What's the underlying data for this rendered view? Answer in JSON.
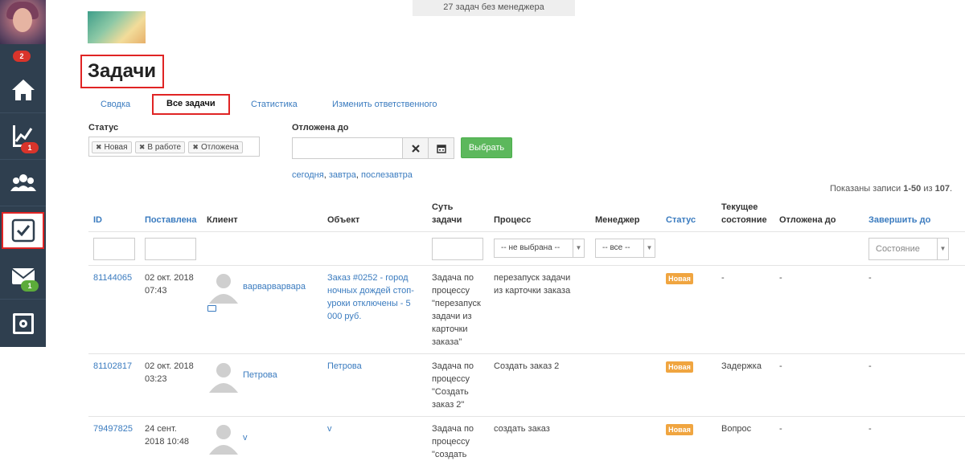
{
  "sidebar": {
    "avatar_badge": "2",
    "items": [
      {
        "name": "home",
        "badge": ""
      },
      {
        "name": "stats",
        "badge": "1"
      },
      {
        "name": "clients",
        "badge": ""
      },
      {
        "name": "tasks",
        "badge": ""
      },
      {
        "name": "mail",
        "badge": "1"
      },
      {
        "name": "safe",
        "badge": ""
      }
    ]
  },
  "header": {
    "banner": "27 задач без менеджера",
    "title": "Задачи"
  },
  "tabs": [
    "Сводка",
    "Все задачи",
    "Статистика",
    "Изменить ответственного"
  ],
  "filters": {
    "status_label": "Статус",
    "status_chips": [
      "Новая",
      "В работе",
      "Отложена"
    ],
    "postponed_label": "Отложена до",
    "choose_button": "Выбрать",
    "quick_today": "сегодня",
    "quick_tomorrow": "завтра",
    "quick_after": "послезавтра"
  },
  "records": {
    "prefix": "Показаны записи ",
    "range": "1-50",
    "middle": " из ",
    "total": "107",
    "suffix": "."
  },
  "table": {
    "headers": {
      "id": "ID",
      "created": "Поставлена",
      "client": "Клиент",
      "object": "Объект",
      "essence_1": "Суть",
      "essence_2": "задачи",
      "process": "Процесс",
      "manager": "Менеджер",
      "status": "Статус",
      "current_1": "Текущее",
      "current_2": "состояние",
      "postponed": "Отложена до",
      "finish": "Завершить до"
    },
    "filter_process": "-- не выбрана --",
    "filter_manager": "-- все --",
    "filter_state": "Состояние",
    "rows": [
      {
        "id": "81144065",
        "date": "02 окт. 2018",
        "time": "07:43",
        "client": "варварварвара",
        "object": [
          "Заказ #0252 - город",
          "ночных дождей стоп-",
          "уроки отключены - 5",
          "000 руб."
        ],
        "essence": [
          "Задача по",
          "процессу",
          "\"перезапуск",
          "задачи из",
          "карточки",
          "заказа\""
        ],
        "process": [
          "перезапуск задачи",
          "из карточки заказа"
        ],
        "status": "Новая",
        "current": "-",
        "postponed": "-",
        "finish": "-"
      },
      {
        "id": "81102817",
        "date": "02 окт. 2018",
        "time": "03:23",
        "client": "Петрова",
        "object": [
          "Петрова"
        ],
        "essence": [
          "Задача по",
          "процессу",
          "\"Создать",
          "заказ 2\""
        ],
        "process": [
          "Создать заказ 2"
        ],
        "status": "Новая",
        "current": "Задержка",
        "postponed": "-",
        "finish": "-"
      },
      {
        "id": "79497825",
        "date": "24 сент.",
        "time": "2018 10:48",
        "client": "v",
        "object": [
          "v"
        ],
        "essence": [
          "Задача по",
          "процессу",
          "\"создать"
        ],
        "process": [
          "создать заказ"
        ],
        "status": "Новая",
        "current": "Вопрос",
        "postponed": "-",
        "finish": "-"
      }
    ]
  },
  "colors": {
    "sidebar": "#2f3f4f",
    "link": "#3a7bbf",
    "highlight": "#e02424",
    "status_new": "#f0a540",
    "button_green": "#5cb85c"
  }
}
